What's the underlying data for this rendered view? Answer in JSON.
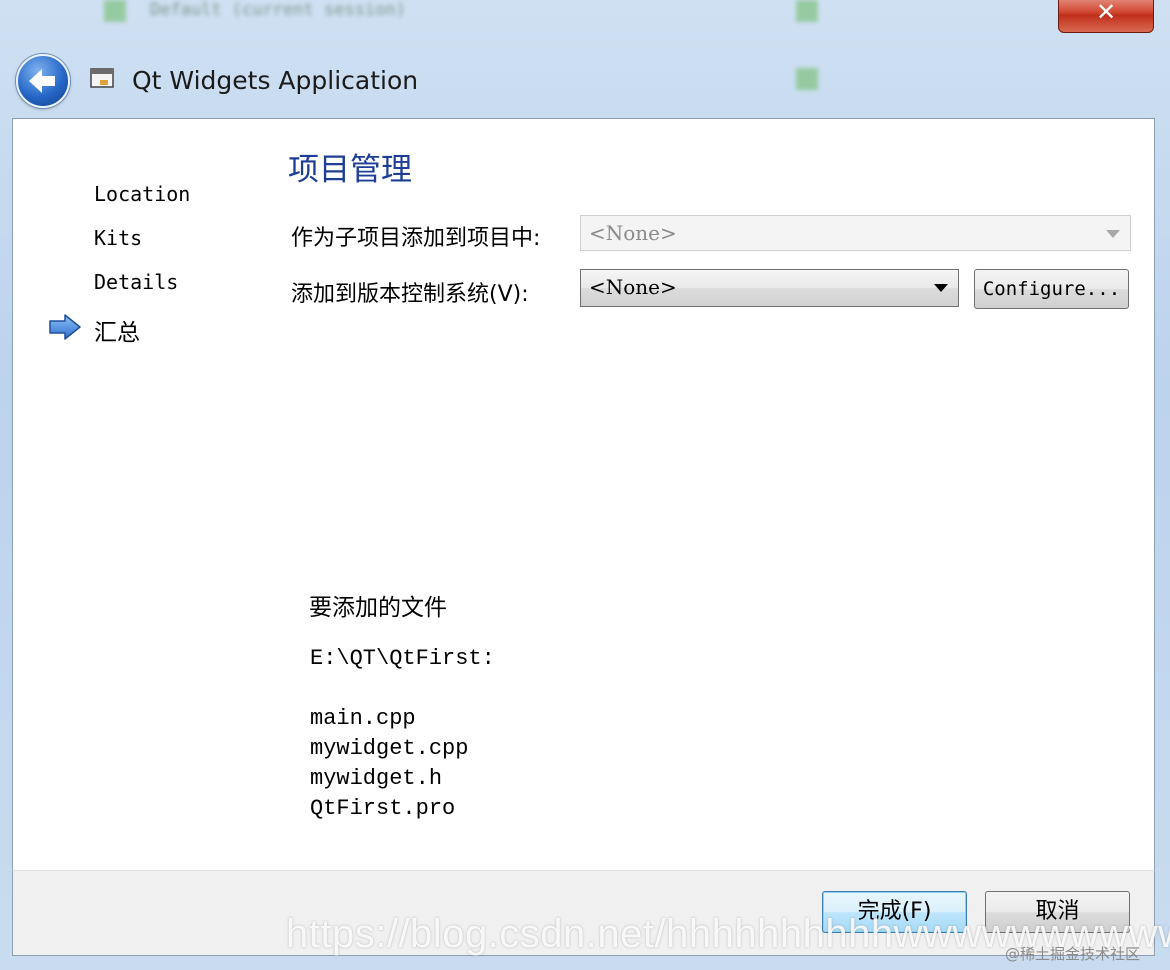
{
  "window": {
    "title": "Qt Widgets Application",
    "close_glyph": "✕"
  },
  "sidebar": {
    "items": [
      {
        "label": "Location"
      },
      {
        "label": "Kits"
      },
      {
        "label": "Details"
      },
      {
        "label": "汇总",
        "current": true
      }
    ]
  },
  "page": {
    "title": "项目管理",
    "add_subproject_label": "作为子项目添加到项目中:",
    "add_subproject_value": "<None>",
    "vcs_label": "添加到版本控制系统(V):",
    "vcs_value": "<None>",
    "configure_label": "Configure..."
  },
  "files": {
    "title": "要添加的文件",
    "directory": "E:\\QT\\QtFirst:",
    "list": [
      "main.cpp",
      "mywidget.cpp",
      "mywidget.h",
      "QtFirst.pro"
    ]
  },
  "buttons": {
    "finish": "完成(F)",
    "cancel": "取消"
  },
  "overlay": {
    "watermark": "https://blog.csdn.net/hhhhhhhhhhwwwwwwwwww",
    "community": "@稀土掘金技术社区"
  },
  "colors": {
    "section_title": "#1c3f95",
    "finish_button_border": "#3c7fb1"
  },
  "icons": {
    "back": "back-arrow-icon",
    "app": "app-window-icon",
    "current_step": "right-arrow-icon"
  }
}
